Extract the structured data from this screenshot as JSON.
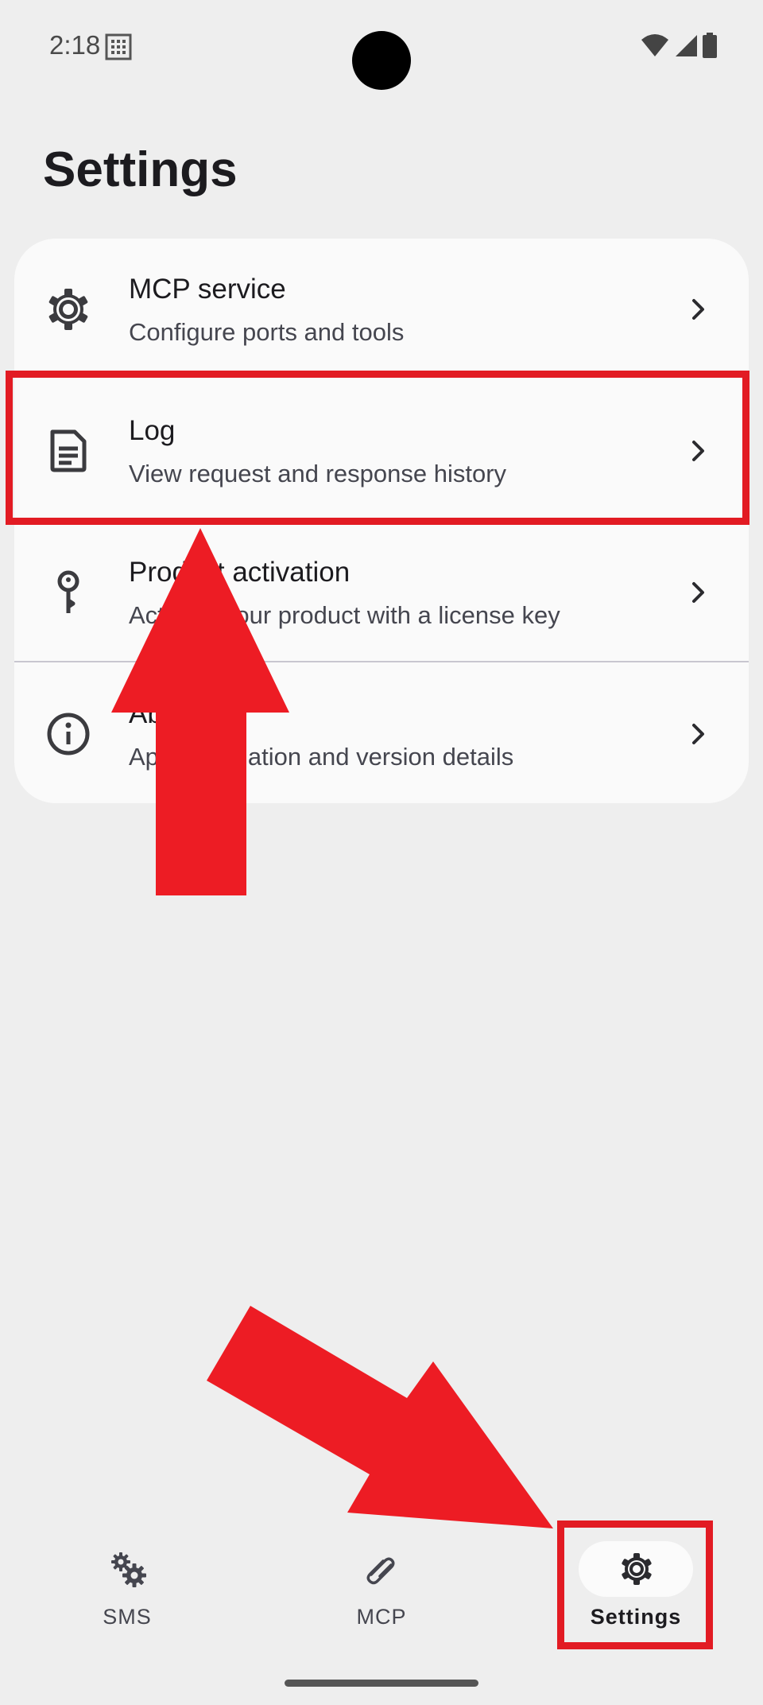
{
  "status_bar": {
    "time": "2:18"
  },
  "header": {
    "title": "Settings"
  },
  "settings_items": [
    {
      "title": "MCP service",
      "subtitle": "Configure ports and tools",
      "icon": "gear-icon"
    },
    {
      "title": "Log",
      "subtitle": "View request and response history",
      "icon": "document-icon"
    },
    {
      "title": "Product activation",
      "subtitle": "Activate your product with a license key",
      "icon": "key-icon"
    },
    {
      "title": "About",
      "subtitle": "App information and version details",
      "icon": "info-icon"
    }
  ],
  "bottom_nav": [
    {
      "label": "SMS",
      "icon": "gears-icon",
      "active": false
    },
    {
      "label": "MCP",
      "icon": "paperclip-icon",
      "active": false
    },
    {
      "label": "Settings",
      "icon": "gear-icon",
      "active": true
    }
  ],
  "colors": {
    "background": "#eeeeee",
    "card": "#fafafa",
    "annotation_red": "#e21b23",
    "nav_pill": "#fbfbfb"
  }
}
